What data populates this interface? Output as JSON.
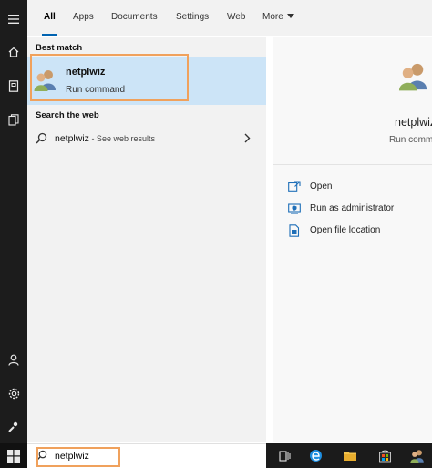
{
  "tabs": [
    {
      "label": "All"
    },
    {
      "label": "Apps"
    },
    {
      "label": "Documents"
    },
    {
      "label": "Settings"
    },
    {
      "label": "Web"
    },
    {
      "label": "More"
    }
  ],
  "results": {
    "best_match_heading": "Best match",
    "best_match": {
      "name": "netplwiz",
      "type": "Run command",
      "icon": "users-icon"
    },
    "web_heading": "Search the web",
    "web_item": {
      "query": "netplwiz",
      "hint": " - See web results"
    }
  },
  "preview": {
    "name": "netplwiz",
    "type": "Run comma",
    "actions": [
      {
        "label": "Open",
        "icon": "open-icon"
      },
      {
        "label": "Run as administrator",
        "icon": "admin-shield-icon"
      },
      {
        "label": "Open file location",
        "icon": "file-location-icon"
      }
    ]
  },
  "search": {
    "value": "netplwiz"
  },
  "colors": {
    "accent": "#0063b1",
    "selection": "#cce4f7",
    "highlight_box": "#f0a15c",
    "rail": "#1c1c1c"
  }
}
